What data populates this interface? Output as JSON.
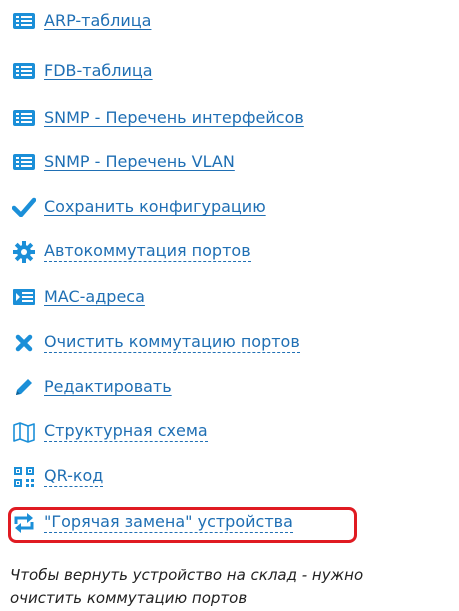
{
  "menu": {
    "items": [
      {
        "label": "ARP-таблица",
        "icon": "list-icon"
      },
      {
        "label": "FDB-таблица",
        "icon": "list-icon"
      },
      {
        "label": "SNMP - Перечень интерфейсов",
        "icon": "list-icon"
      },
      {
        "label": "SNMP - Перечень VLAN",
        "icon": "list-icon"
      },
      {
        "label": "Сохранить конфигурацию",
        "icon": "checkmark-icon"
      },
      {
        "label": "Автокоммутация портов",
        "icon": "gear-icon"
      },
      {
        "label": "MAC-адреса",
        "icon": "mac-list-icon"
      },
      {
        "label": "Очистить коммутацию портов",
        "icon": "close-icon"
      },
      {
        "label": "Редактировать",
        "icon": "pencil-icon"
      },
      {
        "label": "Структурная схема",
        "icon": "map-icon"
      },
      {
        "label": "QR-код",
        "icon": "qr-code-icon"
      },
      {
        "label": "\"Горячая замена\" устройства",
        "icon": "swap-icon"
      }
    ]
  },
  "note": {
    "line1": "Чтобы вернуть устройство на склад - нужно",
    "line2": "очистить коммутацию портов"
  },
  "colors": {
    "link": "#1f6fb4",
    "icon": "#1b8fd8",
    "highlight": "#e01b22"
  }
}
